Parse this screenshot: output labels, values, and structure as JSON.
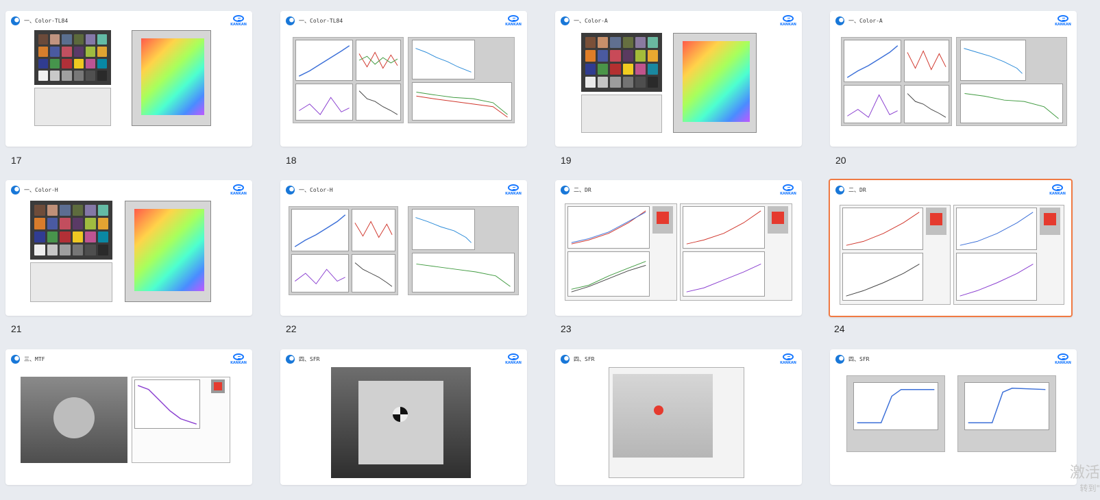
{
  "slides": [
    {
      "num": "17",
      "title": "一、Color-TL84"
    },
    {
      "num": "18",
      "title": "一、Color-TL84"
    },
    {
      "num": "19",
      "title": "一、Color-A"
    },
    {
      "num": "20",
      "title": "一、Color-A"
    },
    {
      "num": "21",
      "title": "一、Color-H"
    },
    {
      "num": "22",
      "title": "一、Color-H"
    },
    {
      "num": "23",
      "title": "二、DR"
    },
    {
      "num": "24",
      "title": "二、DR"
    },
    {
      "num": "",
      "title": "三、MTF"
    },
    {
      "num": "",
      "title": "四、SFR"
    },
    {
      "num": "",
      "title": "四、SFR"
    },
    {
      "num": "",
      "title": "四、SFR"
    }
  ],
  "brand_text": "KANKAN",
  "watermark": {
    "line1": "激活",
    "line2": "转到\""
  },
  "colors": {
    "selected_border": "#f07a43",
    "brand": "#1677ff"
  }
}
